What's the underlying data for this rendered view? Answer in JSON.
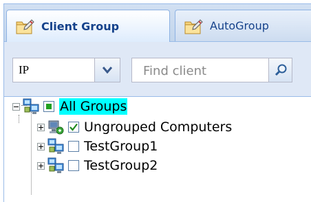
{
  "tabs": [
    {
      "label": "Client Group",
      "active": true,
      "icon": "folder-pencil-icon"
    },
    {
      "label": "AutoGroup",
      "active": false,
      "icon": "folder-pencil-icon"
    }
  ],
  "filter": {
    "field_value": "IP",
    "search_placeholder": "Find client"
  },
  "tree": {
    "root": {
      "label": "All Groups",
      "check": "partial",
      "icon": "network-computers-icon"
    },
    "children": [
      {
        "label": "Ungrouped Computers",
        "check": "checked",
        "icon": "ungrouped-computer-icon"
      },
      {
        "label": "TestGroup1",
        "check": "unchecked",
        "icon": "network-computers-icon"
      },
      {
        "label": "TestGroup2",
        "check": "unchecked",
        "icon": "network-computers-icon"
      }
    ]
  },
  "colors": {
    "selection_highlight": "#00ffff",
    "tab_text": "#15428b",
    "toolbar_bg": "#dfe8f6",
    "partial_check": "#21a121"
  }
}
